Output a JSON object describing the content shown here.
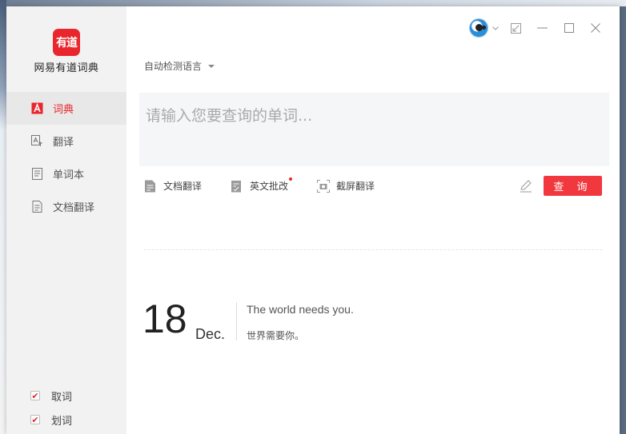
{
  "app": {
    "logo_text": "有道",
    "name": "网易有道词典"
  },
  "sidebar": {
    "items": [
      {
        "label": "词典",
        "icon": "dictionary-icon",
        "active": true
      },
      {
        "label": "翻译",
        "icon": "translate-icon",
        "active": false
      },
      {
        "label": "单词本",
        "icon": "wordbook-icon",
        "active": false
      },
      {
        "label": "文档翻译",
        "icon": "document-icon",
        "active": false
      }
    ],
    "checkboxes": [
      {
        "label": "取词",
        "checked": true
      },
      {
        "label": "划词",
        "checked": true
      }
    ]
  },
  "header": {
    "language_select": "自动检测语言"
  },
  "search": {
    "placeholder": "请输入您要查询的单词..."
  },
  "tools": {
    "doc_translate": "文档翻译",
    "english_correction": "英文批改",
    "screenshot_translate": "截屏翻译",
    "query_button": "查 询"
  },
  "daily": {
    "day": "18",
    "month": "Dec.",
    "quote_en": "The world needs you.",
    "quote_zh": "世界需要你。"
  },
  "colors": {
    "accent": "#e9262d",
    "sidebar_bg": "#f2f2f2",
    "input_bg": "#f5f6f8"
  }
}
